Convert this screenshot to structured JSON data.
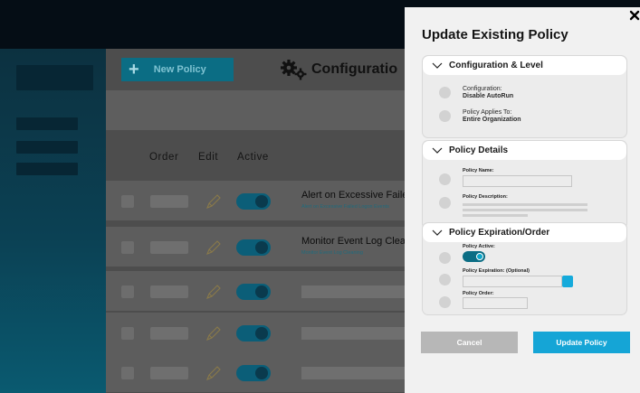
{
  "app": {
    "new_policy_label": "New Policy",
    "config_title": "Configuratio",
    "columns": {
      "order": "Order",
      "edit": "Edit",
      "active": "Active"
    },
    "rows": [
      {
        "name": "Alert on Excessive Faile",
        "subtitle": "Alert on Excessive Failed Logon Events"
      },
      {
        "name": "Monitor Event Log Clea",
        "subtitle": "Monitor Event Log Cleaning"
      }
    ]
  },
  "modal": {
    "title": "Update Existing Policy",
    "close_icon": "close-icon",
    "sections": {
      "config": {
        "title": "Configuration & Level",
        "configuration_label": "Configuration:",
        "configuration_value": "Disable AutoRun",
        "applies_label": "Policy Applies To:",
        "applies_value": "Entire Organization"
      },
      "details": {
        "title": "Policy Details",
        "name_label": "Policy Name:",
        "name_value": "",
        "description_label": "Policy Description:"
      },
      "expiration": {
        "title": "Policy Expiration/Order",
        "active_label": "Policy Active:",
        "active": true,
        "expiration_label": "Policy Expiration: (Optional)",
        "expiration_value": "",
        "order_label": "Policy Order:",
        "order_value": ""
      }
    },
    "buttons": {
      "cancel": "Cancel",
      "update": "Update Policy"
    }
  },
  "colors": {
    "accent": "#15a5d6",
    "toggle_on": "#0b6d84",
    "cancel_gray": "#b7b7b7",
    "topbar": "#050d15"
  }
}
